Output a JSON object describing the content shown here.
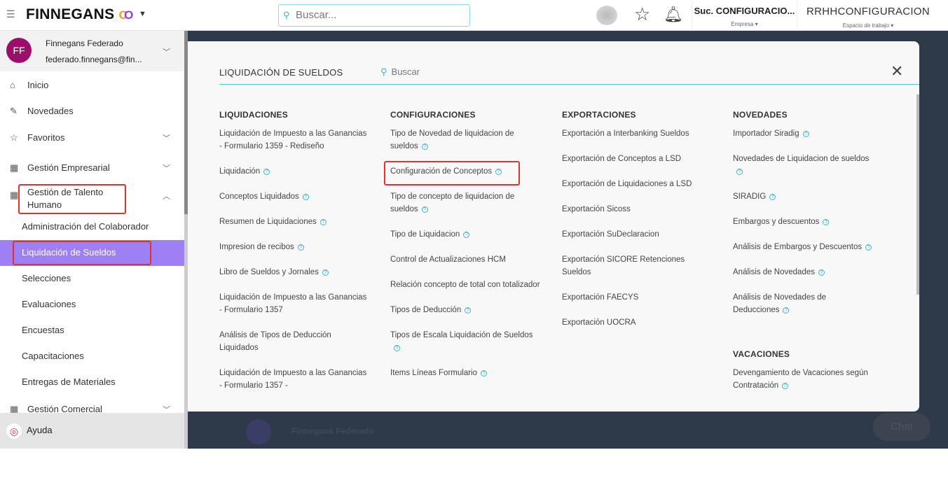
{
  "header": {
    "brand": "FINNEGANS",
    "search_placeholder": "Buscar...",
    "company_value": "Suc. CONFIGURACIO...",
    "company_label": "Empresa ▾",
    "workspace_value": "RRHHCONFIGURACION",
    "workspace_label": "Espacio de trabajo ▾"
  },
  "user": {
    "initials": "FF",
    "name": "Finnegans Federado",
    "email": "federado.finnegans@fin..."
  },
  "sidebar": {
    "items": [
      {
        "label": "Inicio",
        "icon": "home-icon"
      },
      {
        "label": "Novedades",
        "icon": "pin-icon"
      },
      {
        "label": "Favoritos",
        "icon": "star-icon"
      },
      {
        "label": "Gestión Empresarial",
        "icon": "building-icon"
      },
      {
        "label": "Gestión de Talento Humano",
        "icon": "building-icon"
      },
      {
        "label": "Gestión Comercial",
        "icon": "building-icon"
      }
    ],
    "subitems": [
      "Administración del Colaborador",
      "Liquidación de Sueldos",
      "Selecciones",
      "Evaluaciones",
      "Encuestas",
      "Capacitaciones",
      "Entregas de Materiales"
    ],
    "help": "Ayuda",
    "active_color": "#9f7ff4"
  },
  "modal": {
    "title": "LIQUIDACIÓN DE SUELDOS",
    "search_placeholder": "Buscar",
    "columns": [
      {
        "title": "LIQUIDACIONES",
        "items": [
          {
            "t": "Liquidación de Impuesto a las Ganancias - Formulario 1359 - Rediseño",
            "h": false
          },
          {
            "t": "Liquidación",
            "h": true
          },
          {
            "t": "Conceptos Liquidados",
            "h": true
          },
          {
            "t": "Resumen de Liquidaciones",
            "h": true
          },
          {
            "t": "Impresion de recibos",
            "h": true
          },
          {
            "t": "Libro de Sueldos y Jornales",
            "h": true
          },
          {
            "t": "Liquidación de Impuesto a las Ganancias - Formulario 1357",
            "h": false
          },
          {
            "t": "Análisis de Tipos de Deducción Liquidados",
            "h": false
          },
          {
            "t": "Liquidación de Impuesto a las Ganancias - Formulario 1357 -",
            "h": false
          }
        ]
      },
      {
        "title": "CONFIGURACIONES",
        "items": [
          {
            "t": "Tipo de Novedad de liquidacion de sueldos",
            "h": true
          },
          {
            "t": "Configuración de Conceptos",
            "h": true
          },
          {
            "t": "Tipo de concepto de liquidacion de sueldos",
            "h": true
          },
          {
            "t": "Tipo de Liquidacion",
            "h": true
          },
          {
            "t": "Control de Actualizaciones HCM",
            "h": false
          },
          {
            "t": "Relación concepto de total con totalizador",
            "h": false
          },
          {
            "t": "Tipos de Deducción",
            "h": true
          },
          {
            "t": "Tipos de Escala Liquidación de Sueldos",
            "h": true
          },
          {
            "t": "Items Líneas Formulario",
            "h": true
          }
        ]
      },
      {
        "title": "EXPORTACIONES",
        "items": [
          {
            "t": "Exportación a Interbanking Sueldos",
            "h": false
          },
          {
            "t": "Exportación de Conceptos a LSD",
            "h": false
          },
          {
            "t": "Exportación de Liquidaciones a LSD",
            "h": false
          },
          {
            "t": "Exportación Sicoss",
            "h": false
          },
          {
            "t": "Exportación SuDeclaracion",
            "h": false
          },
          {
            "t": "Exportación SICORE Retenciones Sueldos",
            "h": false
          },
          {
            "t": "Exportación FAECYS",
            "h": false
          },
          {
            "t": "Exportación UOCRA",
            "h": false
          }
        ]
      },
      {
        "title": "NOVEDADES",
        "items": [
          {
            "t": "Importador Siradig",
            "h": true
          },
          {
            "t": "Novedades de Liquidacion de sueldos",
            "h": true
          },
          {
            "t": "SIRADIG",
            "h": true
          },
          {
            "t": "Embargos y descuentos",
            "h": true
          },
          {
            "t": "Análisis de Embargos y Descuentos",
            "h": true
          },
          {
            "t": "Análisis de Novedades",
            "h": true
          },
          {
            "t": "Análisis de Novedades de Deducciones",
            "h": true
          }
        ]
      },
      {
        "title": "VACACIONES",
        "items": [
          {
            "t": "Devengamiento de Vacaciones según Contratación",
            "h": true
          }
        ]
      }
    ]
  },
  "background": {
    "user_name": "Finnegans Federado",
    "chat": "Chat"
  }
}
